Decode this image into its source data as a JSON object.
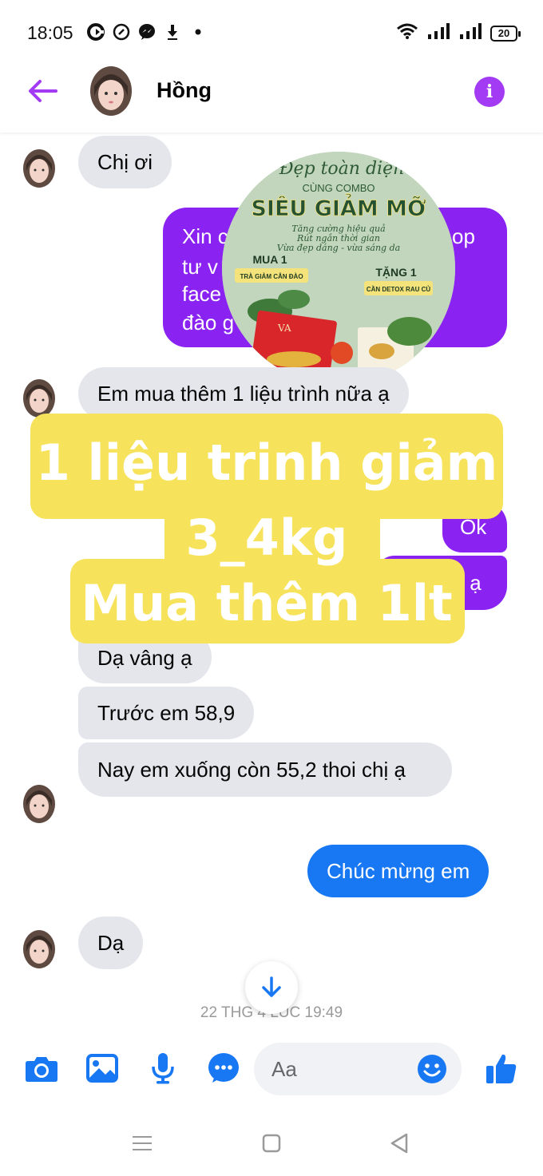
{
  "status_bar": {
    "time": "18:05",
    "battery": "20",
    "left_icons": [
      "ccleaner-icon",
      "shazam-icon",
      "messenger-icon",
      "download-icon",
      "dot-icon"
    ],
    "right_icons": [
      "wifi-icon",
      "signal-icon",
      "signal-icon"
    ]
  },
  "header": {
    "contact_name": "Hồng",
    "back_icon": "arrow-left-icon",
    "info_icon": "info-icon",
    "info_glyph": "i",
    "accent_color": "#a33bf5"
  },
  "messages": [
    {
      "sender": "contact",
      "text": "Chị ơi"
    },
    {
      "sender": "me",
      "text": "Xin c  op tư v  face  đào g"
    },
    {
      "sender": "contact",
      "text": "Em mua thêm 1 liệu trình nữa ạ"
    },
    {
      "sender": "me",
      "text": "Ok"
    },
    {
      "sender": "me",
      "text": "k ạ"
    },
    {
      "sender": "contact",
      "text": "Dạ vâng ạ"
    },
    {
      "sender": "contact",
      "text": "Trước em 58,9"
    },
    {
      "sender": "contact",
      "text": "Nay em xuống còn 55,2 thoi chị ạ"
    },
    {
      "sender": "me",
      "text": "Chúc mừng em"
    },
    {
      "sender": "contact",
      "text": "Dạ"
    }
  ],
  "sent_partial": {
    "line1a": "Xin c",
    "line1b": "op",
    "line2": "tư v",
    "line3": "face",
    "line4": "đào g"
  },
  "promo": {
    "script_title": "Đẹp toàn diện",
    "subtitle": "CÙNG COMBO",
    "title": "SIÊU GIẢM MỠ",
    "tagline1": "Tăng cường hiệu quả",
    "tagline2": "Rút ngắn thời gian",
    "tagline3": "Vừa đẹp dáng - vừa sáng da",
    "buy_label": "MUA 1",
    "buy_item": "TRÀ GIẢM CÂN ĐÀO",
    "gift_label": "TẶNG 1",
    "gift_item": "CẦN DETOX RAU CỦ"
  },
  "overlay": {
    "line1": "1 liệu trinh giảm",
    "line2": "3_4kg",
    "line3": "Mua thêm 1lt",
    "bg_color": "#f7e35b"
  },
  "timestamp": "22 THG 4 LÚC 19:49",
  "composer": {
    "placeholder": "Aa",
    "icons": [
      "camera-icon",
      "image-icon",
      "microphone-icon",
      "more-icon",
      "emoji-icon",
      "thumbs-up-icon"
    ],
    "accent_color": "#1877f2"
  },
  "colors": {
    "bubble_in": "#e4e6eb",
    "bubble_out_purple": "#8a22f2",
    "bubble_out_blue": "#1877f2"
  }
}
